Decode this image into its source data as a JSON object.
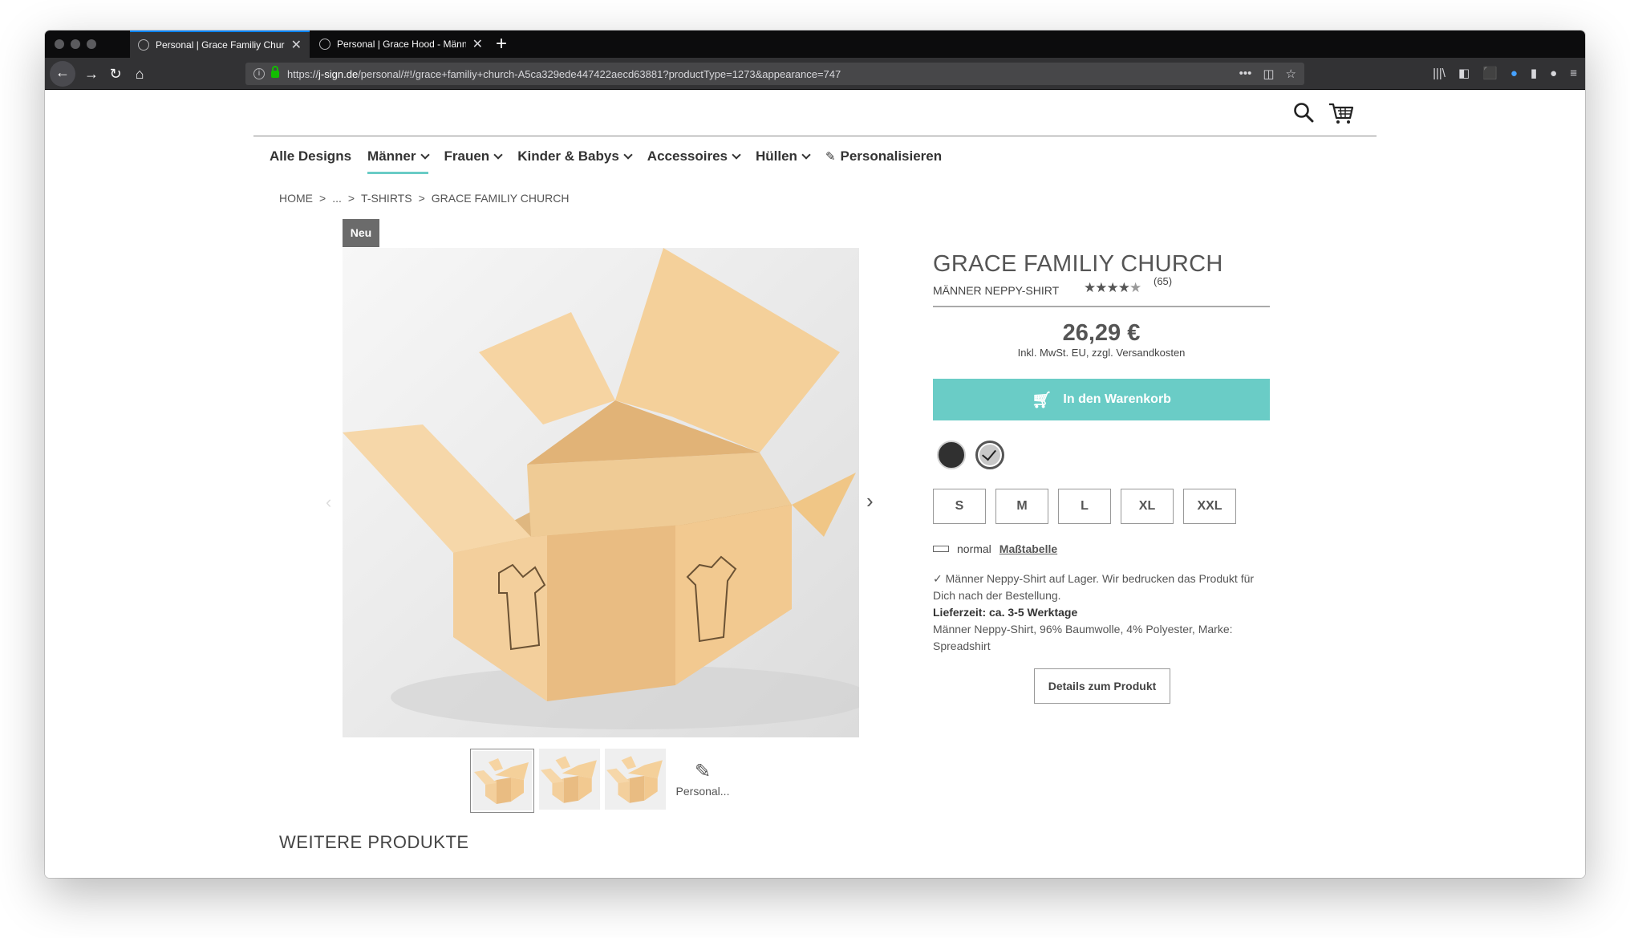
{
  "browser": {
    "tabs": [
      {
        "title": "Personal | Grace Familiy Church"
      },
      {
        "title": "Personal | Grace Hood - Männer"
      }
    ],
    "url_prefix": "https://",
    "url_domain": "j-sign.de",
    "url_path": "/personal/#!/grace+familiy+church-A5ca329ede447422aecd63881?productType=1273&appearance=747"
  },
  "nav": {
    "items": [
      {
        "label": "Alle Designs",
        "dropdown": false
      },
      {
        "label": "Männer",
        "dropdown": true,
        "active": true
      },
      {
        "label": "Frauen",
        "dropdown": true
      },
      {
        "label": "Kinder & Babys",
        "dropdown": true
      },
      {
        "label": "Accessoires",
        "dropdown": true
      },
      {
        "label": "Hüllen",
        "dropdown": true
      },
      {
        "label": "Personalisieren",
        "dropdown": false
      }
    ]
  },
  "breadcrumb": {
    "home": "HOME",
    "sep": ">",
    "ellipsis": "...",
    "category": "T-SHIRTS",
    "current": "GRACE FAMILIY CHURCH"
  },
  "product": {
    "badge": "Neu",
    "title": "GRACE FAMILIY CHURCH",
    "subtitle": "MÄNNER NEPPY-SHIRT",
    "rating": 4.5,
    "rating_count": "(65)",
    "price": "26,29 €",
    "vat_note": "Inkl. MwSt. EU, zzgl. Versandkosten",
    "cart_button": "In den Warenkorb",
    "colors": [
      {
        "name": "black",
        "hex": "#303030",
        "selected": false
      },
      {
        "name": "light grey",
        "hex": "#c8c8c8",
        "selected": true
      }
    ],
    "sizes": [
      "S",
      "M",
      "L",
      "XL",
      "XXL"
    ],
    "fit_label": "normal",
    "size_chart_link": "Maßtabelle",
    "stock_line": "✓ Männer Neppy-Shirt auf Lager. Wir bedrucken das Produkt für Dich nach der Bestellung.",
    "delivery": "Lieferzeit: ca. 3-5 Werktage",
    "material": "Männer Neppy-Shirt, 96% Baumwolle, 4% Polyester, Marke: Spreadshirt",
    "details_button": "Details zum Produkt",
    "personalize_thumb": "Personal..."
  },
  "more_products_heading": "WEITERE PRODUKTE",
  "colors": {
    "accent": "#6accc6",
    "browser_dark": "#0c0c0d",
    "text": "#555555"
  }
}
